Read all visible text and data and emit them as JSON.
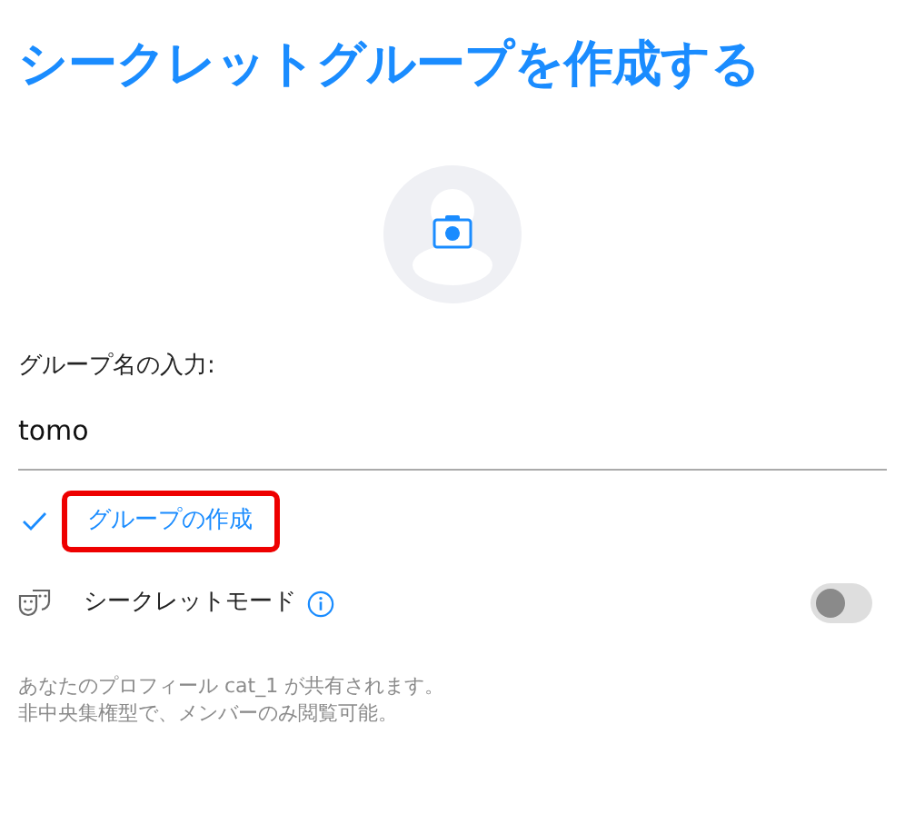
{
  "title": "シークレットグループを作成する",
  "group_name": {
    "label": "グループ名の入力:",
    "value": "tomo"
  },
  "create_button": {
    "label": "グループの作成",
    "highlighted": true
  },
  "secret_mode": {
    "label": "シークレットモード",
    "on": false
  },
  "footer_lines": [
    "あなたのプロフィール cat_1 が共有されます。",
    "非中央集権型で、メンバーのみ閲覧可能。"
  ]
}
